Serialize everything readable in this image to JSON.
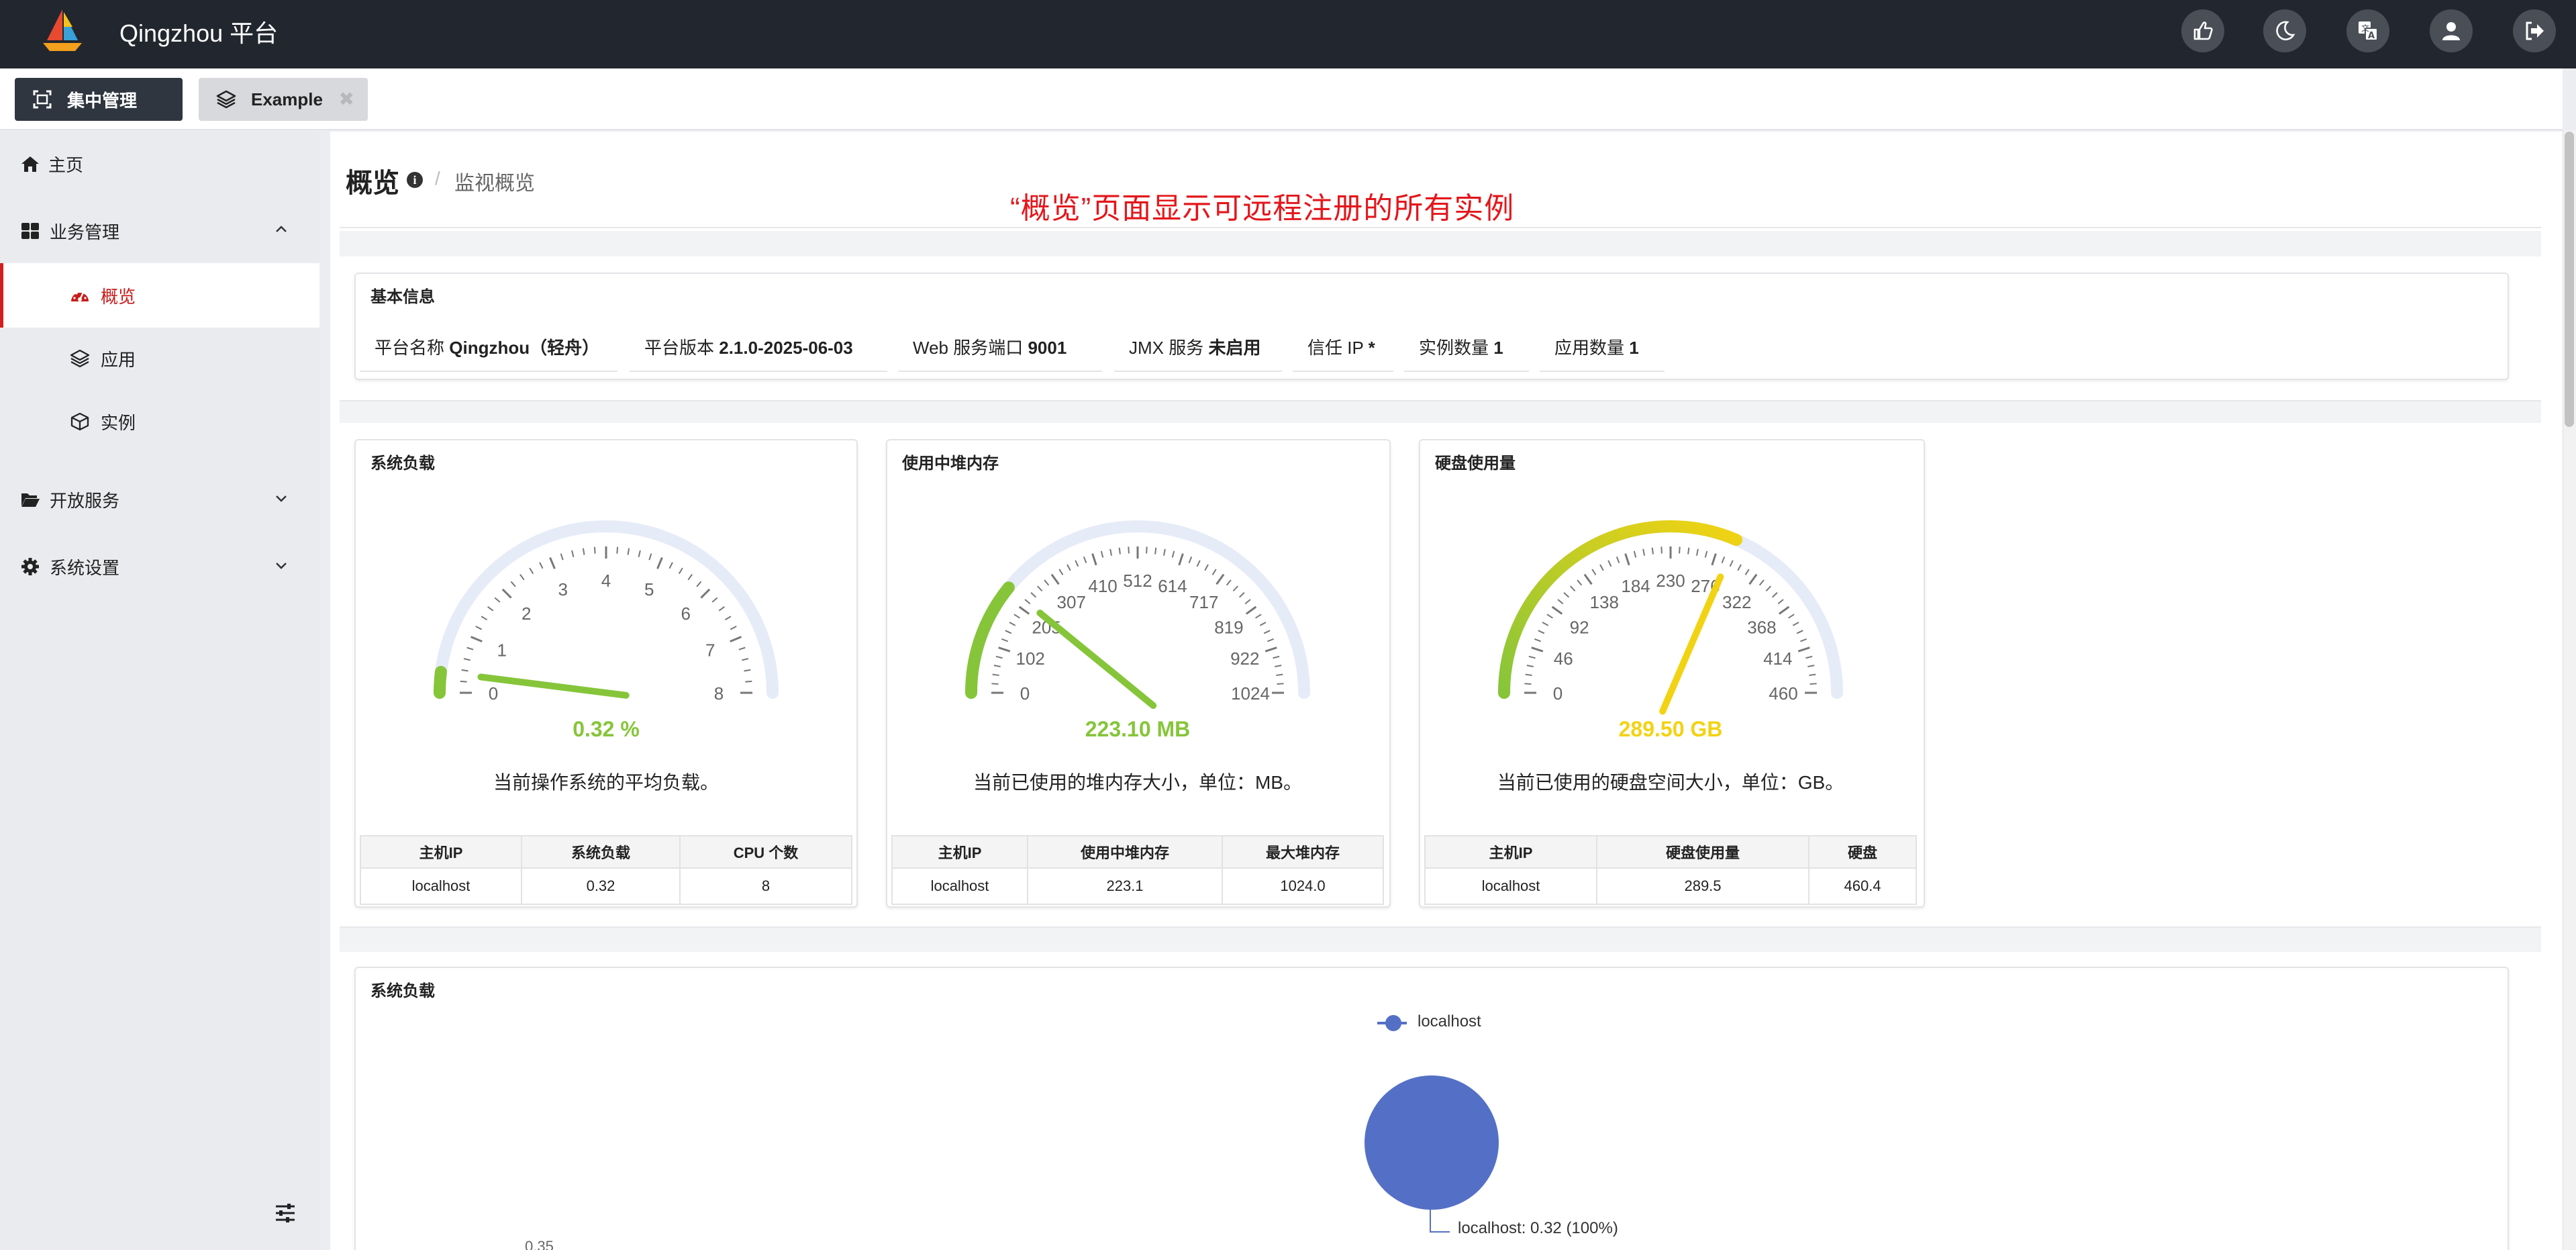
{
  "app": {
    "title": "Qingzhou 平台"
  },
  "tabs": [
    {
      "label": "集中管理"
    },
    {
      "label": "Example",
      "close": "✖"
    }
  ],
  "sidebar": {
    "items": [
      {
        "label": "主页",
        "icon": "home-icon"
      },
      {
        "label": "业务管理",
        "icon": "dashboard-grid-icon"
      },
      {
        "label": "概览",
        "icon": "tachometer-icon",
        "active": true
      },
      {
        "label": "应用",
        "icon": "layers-icon"
      },
      {
        "label": "实例",
        "icon": "cube-icon"
      },
      {
        "label": "开放服务",
        "icon": "folder-open-icon"
      },
      {
        "label": "系统设置",
        "icon": "cog-icon"
      }
    ]
  },
  "page": {
    "title": "概览",
    "breadcrumb_sep": "/",
    "breadcrumb": "监视概览",
    "annotation": "“概览”页面显示可远程注册的所有实例"
  },
  "basic_info": {
    "title": "基本信息",
    "items": [
      {
        "label": "平台名称",
        "value": "Qingzhou（轻舟）"
      },
      {
        "label": "平台版本",
        "value": "2.1.0-2025-06-03"
      },
      {
        "label": "Web 服务端口",
        "value": "9001"
      },
      {
        "label": "JMX 服务",
        "value": "未启用"
      },
      {
        "label": "信任 IP",
        "value": "*"
      },
      {
        "label": "实例数量",
        "value": "1"
      },
      {
        "label": "应用数量",
        "value": "1"
      }
    ]
  },
  "gauges": [
    {
      "title": "系统负载",
      "value": "0.32 %",
      "desc": "当前操作系统的平均负载。",
      "min": 0,
      "max": 8,
      "current": 0.32,
      "color": "#86c53a",
      "ticks": [
        "0",
        "1",
        "2",
        "3",
        "4",
        "5",
        "6",
        "7",
        "8"
      ],
      "table": {
        "headers": [
          "主机IP",
          "系统负载",
          "CPU 个数"
        ],
        "rows": [
          [
            "localhost",
            "0.32",
            "8"
          ]
        ]
      }
    },
    {
      "title": "使用中堆内存",
      "value": "223.10 MB",
      "desc": "当前已使用的堆内存大小，单位：MB。",
      "min": 0,
      "max": 1024,
      "current": 223.1,
      "color": "#86c53a",
      "ticks": [
        "0",
        "102",
        "205",
        "307",
        "410",
        "512",
        "614",
        "717",
        "819",
        "922",
        "1024"
      ],
      "table": {
        "headers": [
          "主机IP",
          "使用中堆内存",
          "最大堆内存"
        ],
        "rows": [
          [
            "localhost",
            "223.1",
            "1024.0"
          ]
        ]
      }
    },
    {
      "title": "硬盘使用量",
      "value": "289.50 GB",
      "desc": "当前已使用的硬盘空间大小，单位：GB。",
      "min": 0,
      "max": 460,
      "current": 289.5,
      "color": "#f2d313",
      "ticks": [
        "0",
        "46",
        "92",
        "138",
        "184",
        "230",
        "276",
        "322",
        "368",
        "414",
        "460"
      ],
      "table": {
        "headers": [
          "主机IP",
          "硬盘使用量",
          "硬盘"
        ],
        "rows": [
          [
            "localhost",
            "289.5",
            "460.4"
          ]
        ]
      }
    }
  ],
  "load_chart": {
    "title": "系统负载",
    "legend": "localhost",
    "pie_label": "localhost: 0.32 (100%)",
    "axis_tick": "0.35"
  },
  "chart_data": {
    "type": "pie",
    "title": "系统负载",
    "categories": [
      "localhost"
    ],
    "values": [
      0.32
    ],
    "percent": [
      100
    ]
  }
}
